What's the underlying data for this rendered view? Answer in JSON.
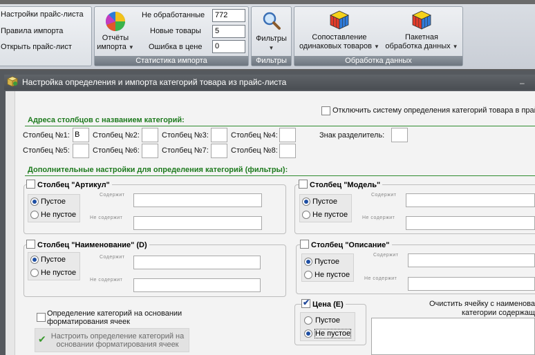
{
  "ribbon": {
    "menu_items": [
      "Настройки прайс-листа",
      "Правила импорта",
      "Открыть прайс-лист"
    ],
    "reports": {
      "label_line1": "Отчёты",
      "label_line2": "импорта",
      "icon": "pie-chart-icon"
    },
    "stats": {
      "rows": [
        {
          "label": "Не обработанные",
          "value": "772"
        },
        {
          "label": "Новые товары",
          "value": "5"
        },
        {
          "label": "Ошибка в цене",
          "value": "0"
        }
      ],
      "group_title": "Статистика импорта"
    },
    "filters": {
      "label": "Фильтры",
      "group_title": "Фильтры",
      "icon": "magnifier-icon"
    },
    "processing": {
      "button1_line1": "Сопоставление",
      "button1_line2": "одинаковых товаров",
      "button2_line1": "Пакетная",
      "button2_line2": "обработка данных",
      "group_title": "Обработка данных",
      "icon": "rubiks-cube-icon"
    },
    "colors": {
      "group_title_bg": "#7b838c",
      "ribbon_bg": "#d9dde3"
    }
  },
  "dialog": {
    "title": "Настройка определения и импорта категорий товара из прайс-листа",
    "title_icon": "package-icon",
    "disable_system_label": "Отключить систему определения категорий товара в прай",
    "addresses": {
      "section_title": "Адреса столбцов с названием категорий:",
      "columns": [
        {
          "label": "Столбец №1:",
          "value": "B"
        },
        {
          "label": "Столбец №2:",
          "value": ""
        },
        {
          "label": "Столбец №3:",
          "value": ""
        },
        {
          "label": "Столбец №4:",
          "value": ""
        },
        {
          "label": "Столбец №5:",
          "value": ""
        },
        {
          "label": "Столбец №6:",
          "value": ""
        },
        {
          "label": "Столбец №7:",
          "value": ""
        },
        {
          "label": "Столбец №8:",
          "value": ""
        }
      ],
      "separator_label": "Знак разделитель:",
      "separator_value": ""
    },
    "filters_section_title": "Дополнительные настройки для определения категорий (фильтры):",
    "filter_groups": [
      {
        "title": "Столбец \"Артикул\"",
        "checked": false,
        "options": [
          "Пустое",
          "Не пустое"
        ],
        "selected": 0,
        "contains_label": "Содержит",
        "not_contains_label": "Не содержит"
      },
      {
        "title": "Столбец \"Модель\"",
        "checked": false,
        "options": [
          "Пустое",
          "Не пустое"
        ],
        "selected": 0,
        "contains_label": "Содержит",
        "not_contains_label": "Не содержит"
      },
      {
        "title": "Столбец \"Наименование\" (D)",
        "checked": false,
        "options": [
          "Пустое",
          "Не пустое"
        ],
        "selected": 0,
        "contains_label": "Содержит",
        "not_contains_label": "Не содержит"
      },
      {
        "title": "Столбец \"Описание\"",
        "checked": false,
        "options": [
          "Пустое",
          "Не пустое"
        ],
        "selected": 0,
        "contains_label": "Содержит",
        "not_contains_label": "Не содержит"
      },
      {
        "title": "Цена (E)",
        "checked": true,
        "options": [
          "Пустое",
          "Не пустое"
        ],
        "selected": 1
      }
    ],
    "formatting": {
      "checkbox_line1": "Определение категорий на основании",
      "checkbox_line2": "форматирования ячеек",
      "button_line1": "Настроить определение категорий на",
      "button_line2": "основании форматирования ячеек",
      "button_icon": "green-check-icon"
    },
    "clear_cell": {
      "label_line1": "Очистить ячейку с наименова",
      "label_line2": "категории содержащ",
      "value": ""
    }
  }
}
